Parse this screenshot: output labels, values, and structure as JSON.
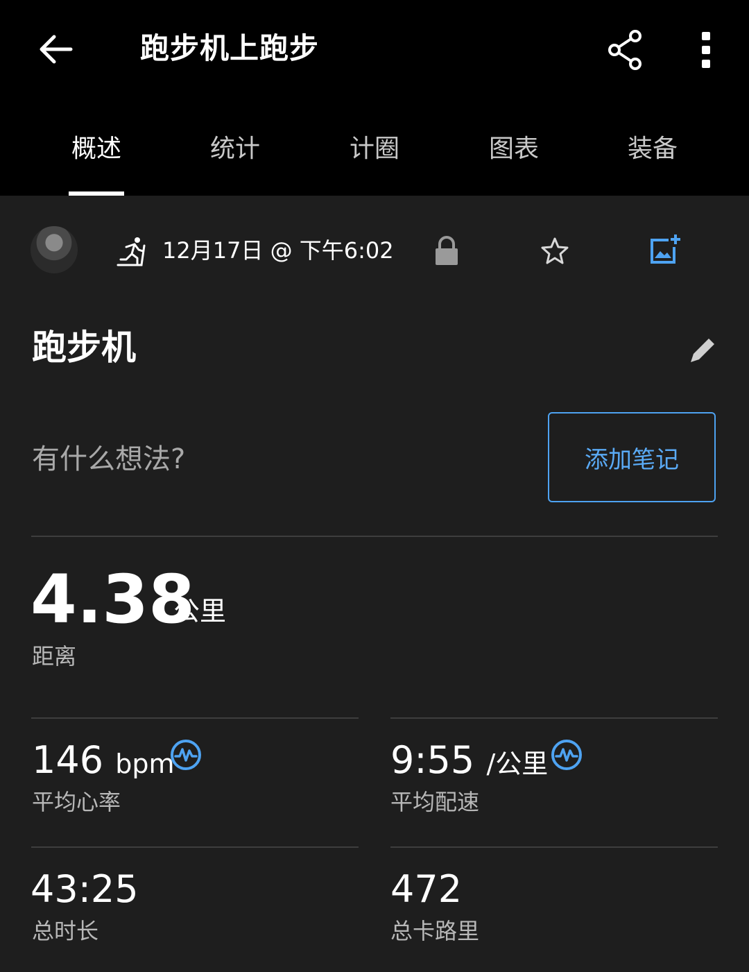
{
  "header": {
    "title": "跑步机上跑步",
    "back_icon": "arrow-left-icon",
    "share_icon": "share-icon",
    "more_icon": "more-vert-icon"
  },
  "tabs": [
    {
      "label": "概述",
      "active": true
    },
    {
      "label": "统计",
      "active": false
    },
    {
      "label": "计圈",
      "active": false
    },
    {
      "label": "图表",
      "active": false
    },
    {
      "label": "装备",
      "active": false
    }
  ],
  "activity_meta": {
    "type_icon": "treadmill-run-icon",
    "datetime": "12月17日 @ 下午6:02",
    "privacy_icon": "lock-icon",
    "favorite_icon": "star-outline-icon",
    "add_photo_icon": "add-photo-icon"
  },
  "activity": {
    "name": "跑步机",
    "edit_icon": "pencil-icon"
  },
  "notes": {
    "prompt": "有什么想法?",
    "button_label": "添加笔记"
  },
  "distance": {
    "value": "4.38",
    "unit": "公里",
    "label": "距离"
  },
  "stats": {
    "heart_rate": {
      "value": "146",
      "unit": "bpm",
      "label": "平均心率"
    },
    "pace": {
      "value": "9:55",
      "unit": "/公里",
      "label": "平均配速"
    },
    "duration": {
      "value": "43:25",
      "label": "总时长"
    },
    "calories": {
      "value": "472",
      "label": "总卡路里"
    }
  },
  "colors": {
    "background": "#1e1e1e",
    "topbar": "#000000",
    "accent": "#4ea3f2",
    "muted_text": "#a9a9a9"
  }
}
